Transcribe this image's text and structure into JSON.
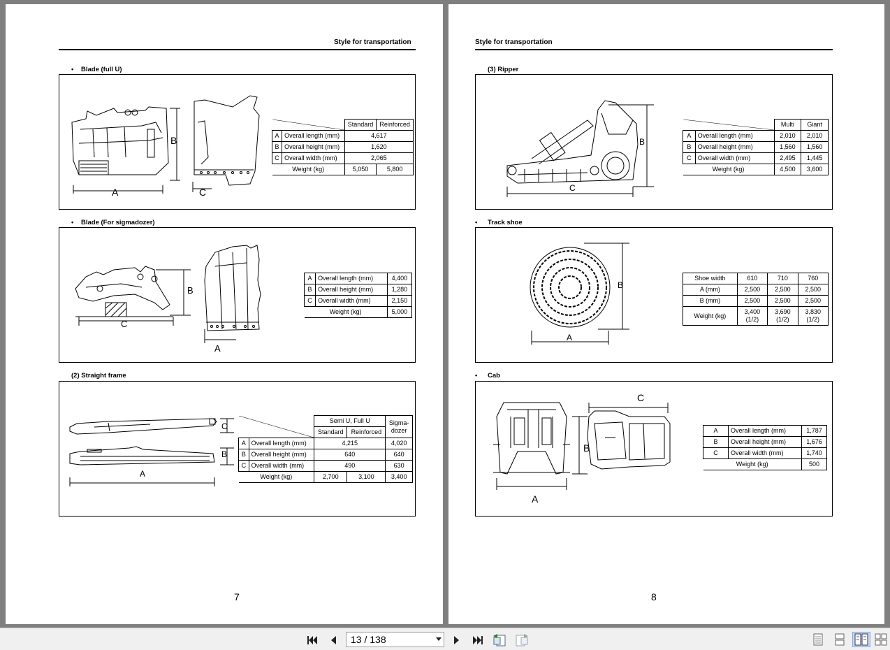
{
  "viewer": {
    "page_field": "13 / 138",
    "buttons": {
      "first_page": "first-page",
      "prev_page": "previous-page",
      "next_page": "next-page",
      "last_page": "last-page"
    }
  },
  "left_page": {
    "header": "Style for transportation",
    "page_number": "7",
    "blade_full_u": {
      "bullet": "•",
      "title": "Blade (full U)",
      "dim_labels": {
        "a": "A",
        "b": "B",
        "c": "C"
      },
      "columns": [
        "Standard",
        "Reinforced"
      ],
      "rows": [
        {
          "key": "A",
          "label": "Overall length (mm)",
          "value": "4,617"
        },
        {
          "key": "B",
          "label": "Overall height (mm)",
          "value": "1,620"
        },
        {
          "key": "C",
          "label": "Overall width (mm)",
          "value": "2,065"
        }
      ],
      "weight_label": "Weight (kg)",
      "weight_values": [
        "5,050",
        "5,800"
      ]
    },
    "blade_sigmadozer": {
      "bullet": "•",
      "title": "Blade (For sigmadozer)",
      "dim_labels": {
        "a": "A",
        "b": "B",
        "c": "C"
      },
      "rows": [
        {
          "key": "A",
          "label": "Overall length (mm)",
          "value": "4,400"
        },
        {
          "key": "B",
          "label": "Overall height (mm)",
          "value": "1,280"
        },
        {
          "key": "C",
          "label": "Overall width (mm)",
          "value": "2,150"
        }
      ],
      "weight_label": "Weight (kg)",
      "weight_value": "5,000"
    },
    "straight_frame": {
      "title": "(2)  Straight frame",
      "dim_labels": {
        "a": "A",
        "b": "B",
        "c": "C"
      },
      "group_header": "Semi U, Full U",
      "sub_columns": [
        "Standard",
        "Reinforced"
      ],
      "last_column": "Sigma-\ndozer",
      "rows": [
        {
          "key": "A",
          "label": "Overall length (mm)",
          "value": "4,215",
          "sigma": "4,020"
        },
        {
          "key": "B",
          "label": "Overall height (mm)",
          "value": "640",
          "sigma": "640"
        },
        {
          "key": "C",
          "label": "Overall width (mm)",
          "value": "490",
          "sigma": "630"
        }
      ],
      "weight_label": "Weight (kg)",
      "weight_values": [
        "2,700",
        "3,100",
        "3,400"
      ]
    }
  },
  "right_page": {
    "header": "Style for transportation",
    "page_number": "8",
    "ripper": {
      "title": "(3)  Ripper",
      "dim_labels": {
        "b": "B",
        "c": "C"
      },
      "columns": [
        "Multi",
        "Giant"
      ],
      "rows": [
        {
          "key": "A",
          "label": "Overall length (mm)",
          "values": [
            "2,010",
            "2,010"
          ]
        },
        {
          "key": "B",
          "label": "Overall height (mm)",
          "values": [
            "1,560",
            "1,560"
          ]
        },
        {
          "key": "C",
          "label": "Overall width (mm)",
          "values": [
            "2,495",
            "1,445"
          ]
        }
      ],
      "weight_label": "Weight (kg)",
      "weight_values": [
        "4,500",
        "3,600"
      ]
    },
    "track_shoe": {
      "bullet": "•",
      "title": "Track shoe",
      "dim_labels": {
        "a": "A",
        "b": "B"
      },
      "columns": [
        "Shoe width",
        "610",
        "710",
        "760"
      ],
      "rows": [
        {
          "label": "A (mm)",
          "values": [
            "2,500",
            "2,500",
            "2,500"
          ]
        },
        {
          "label": "B (mm)",
          "values": [
            "2,500",
            "2,500",
            "2,500"
          ]
        }
      ],
      "weight_label": "Weight (kg)",
      "weight_values": [
        "3,400",
        "3,690",
        "3,830"
      ],
      "weight_note": "(1/2)"
    },
    "cab": {
      "bullet": "•",
      "title": "Cab",
      "dim_labels": {
        "a": "A",
        "b": "B",
        "c": "C"
      },
      "rows": [
        {
          "key": "A",
          "label": "Overall length (mm)",
          "value": "1,787"
        },
        {
          "key": "B",
          "label": "Overall height (mm)",
          "value": "1,676"
        },
        {
          "key": "C",
          "label": "Overall width (mm)",
          "value": "1,740"
        }
      ],
      "weight_label": "Weight (kg)",
      "weight_value": "500"
    }
  }
}
